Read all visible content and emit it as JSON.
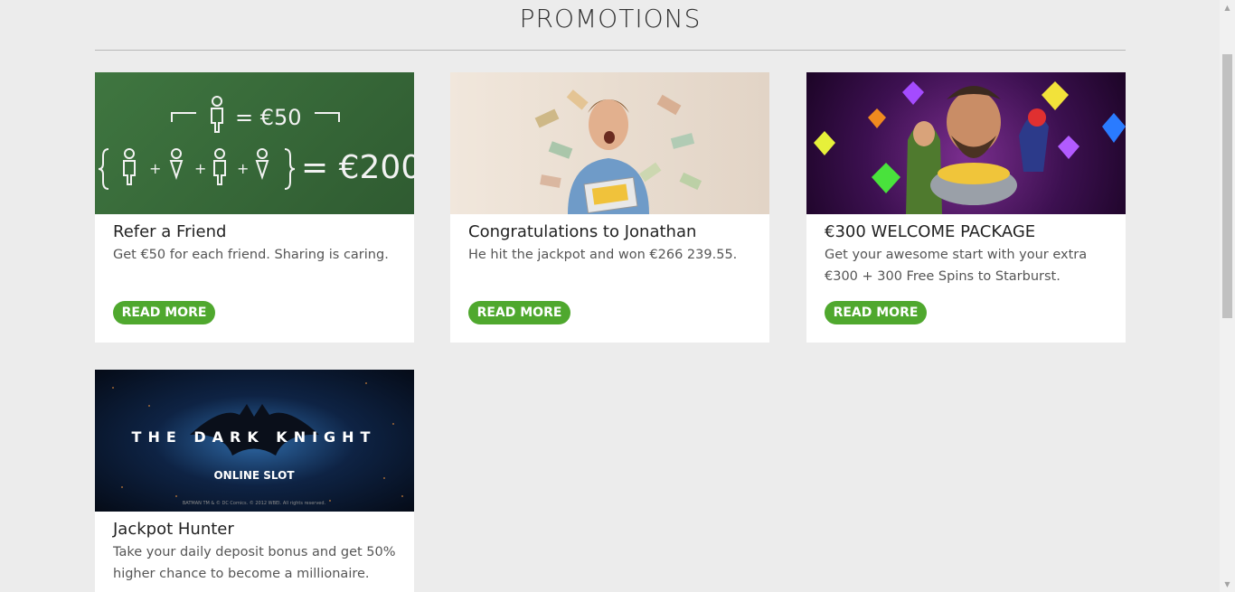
{
  "page": {
    "title": "PROMOTIONS"
  },
  "promotions": [
    {
      "title": "Refer a Friend",
      "description": "Get €50 for each friend. Sharing is caring.",
      "button": "READ MORE",
      "image": {
        "line1": "= €50",
        "line2": "= €200"
      }
    },
    {
      "title": "Congratulations to Jonathan",
      "description": "He hit the jackpot and won €266 239.55.",
      "button": "READ MORE"
    },
    {
      "title": "€300 WELCOME PACKAGE",
      "description": "Get your awesome start with your extra €300 + 300 Free Spins to Starburst.",
      "button": "READ MORE"
    },
    {
      "title": "Jackpot Hunter",
      "description": "Take your daily deposit bonus and get 50% higher chance to become a millionaire.",
      "image": {
        "title": "THE DARK KNIGHT",
        "subtitle": "ONLINE SLOT",
        "fineprint": "BATMAN TM & © DC Comics. © 2012 WBEI. All rights reserved."
      }
    }
  ],
  "colors": {
    "button": "#4fa82e",
    "background": "#ececec",
    "card": "#ffffff"
  }
}
